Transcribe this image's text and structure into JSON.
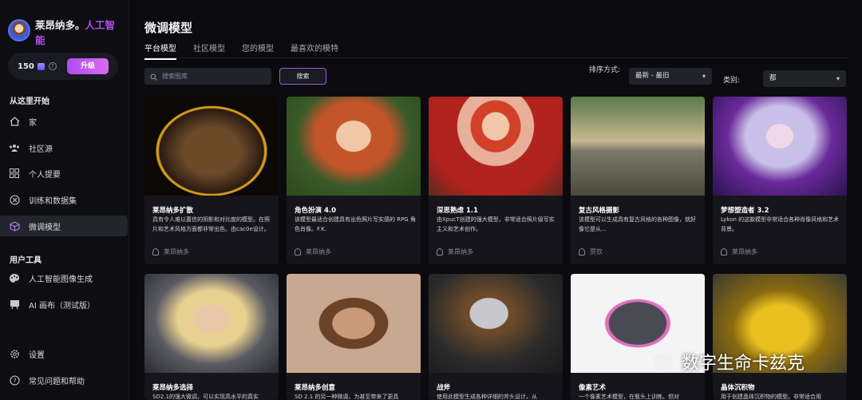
{
  "brand": {
    "name_part1": "莱昂纳多。",
    "name_part2": "人工智",
    "name_part3": "能"
  },
  "credits": {
    "count": "150",
    "upgrade_label": "升级"
  },
  "sidebar": {
    "start_title": "从这里开始",
    "start_items": [
      {
        "label": "家",
        "icon": "home-icon"
      },
      {
        "label": "社区源",
        "icon": "community-icon"
      },
      {
        "label": "个人提要",
        "icon": "grid-icon"
      },
      {
        "label": "训练和数据集",
        "icon": "dataset-icon"
      },
      {
        "label": "微调模型",
        "icon": "cube-icon"
      }
    ],
    "tools_title": "用户工具",
    "tools_items": [
      {
        "label": "人工智能图像生成",
        "icon": "palette-icon"
      },
      {
        "label": "AI 画布（测试版）",
        "icon": "canvas-icon"
      }
    ],
    "bottom_items": [
      {
        "label": "设置",
        "icon": "gear-icon"
      },
      {
        "label": "常见问题和帮助",
        "icon": "help-icon"
      }
    ]
  },
  "main": {
    "title": "微调模型",
    "tabs": [
      "平台模型",
      "社区模型",
      "您的模型",
      "最喜欢的模特"
    ],
    "search_placeholder": "搜索图库",
    "search_button": "搜索",
    "sort_label": "排序方式:",
    "sort_value": "最新 - 最旧",
    "category_label": "类别:",
    "category_value": "都"
  },
  "cards": [
    {
      "title": "莱昂纳多扩散",
      "desc": "具有令人难以置信的阴影和对比度的模型。在照片和艺术风格方面都非常出色。由cac0e设计。",
      "author": "莱昂纳多"
    },
    {
      "title": "角色扮演 4.0",
      "desc": "该模型最适合创建具有出色照片写实感的 RPG 角色肖像。F.K.",
      "author": "莱昂纳多"
    },
    {
      "title": "深思熟虑 1.1",
      "desc": "由XpucT创建的强大模型，非常适合照片级写实主义和艺术创作。",
      "author": "莱昂纳多"
    },
    {
      "title": "复古风格摄影",
      "desc": "该模型可以生成具有复古风格的各种图像，就好像它是从...",
      "author": "贾钦"
    },
    {
      "title": "梦想塑造者 3.2",
      "desc": "Lykon 的这款模型非常适合各种肖像风格和艺术背景。",
      "author": "莱昂纳多"
    },
    {
      "title": "莱昂纳多选择",
      "desc": "SD2.1的强大微调，可以实现高水平的真实",
      "author": ""
    },
    {
      "title": "莱昂纳多创意",
      "desc": "SD 2.1 的另一种微调，为甚至带来了更具",
      "author": ""
    },
    {
      "title": "战斧",
      "desc": "使用此模型生成各种详细的斧头设计。从",
      "author": ""
    },
    {
      "title": "像素艺术",
      "desc": "一个像素艺术模型，在瓶头上训练。但对",
      "author": ""
    },
    {
      "title": "晶体沉积物",
      "desc": "用于创建晶体沉积物的模型。非常适合用",
      "author": ""
    }
  ],
  "watermark": "数字生命卡兹克"
}
